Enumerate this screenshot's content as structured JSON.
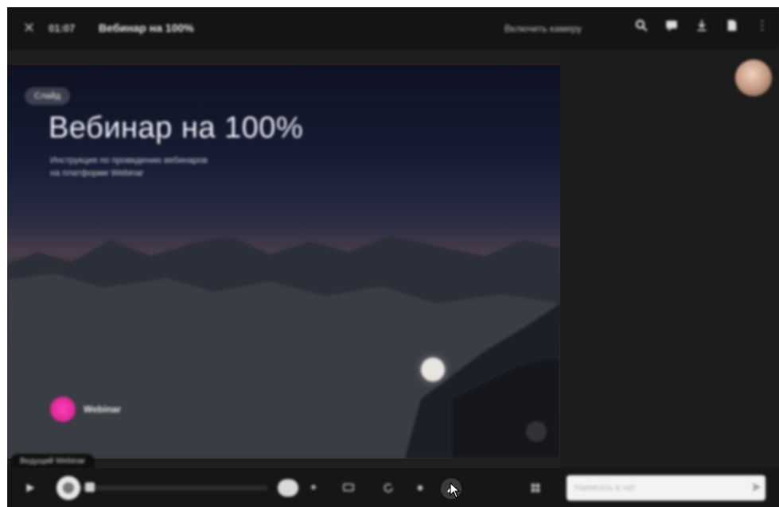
{
  "header": {
    "close_icon": "close-icon",
    "time": "01:07",
    "title": "Вебинар на 100%",
    "camera_label": "Включить камеру",
    "icons": [
      "search-icon",
      "chat-icon",
      "download-icon",
      "document-icon",
      "more-vertical-icon"
    ]
  },
  "slide": {
    "pill": "Слайд",
    "headline": "Вебинар на 100%",
    "subtitle_line1": "Инструкция по проведению вебинаров",
    "subtitle_line2": "на платформе Webinar",
    "brand_name": "Webinar"
  },
  "speaker": {
    "name": "Ведущий Webinar"
  },
  "chat": {
    "input_placeholder": "Написать в чат"
  },
  "colors": {
    "app_bg": "#1f1f1f",
    "topbar_bg": "#141414",
    "brand_pink": "#e02a99",
    "input_bg": "#f3f3f3"
  }
}
